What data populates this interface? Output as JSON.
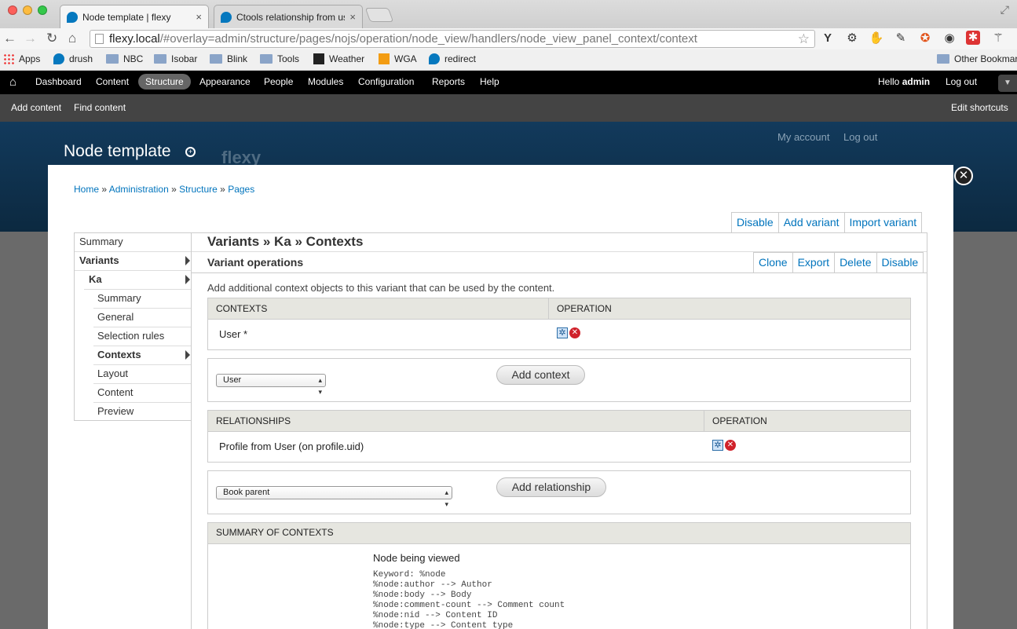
{
  "browser": {
    "tabs": [
      {
        "title": "Node template | flexy",
        "close": "×"
      },
      {
        "title": "Ctools relationship from us",
        "close": "×"
      }
    ],
    "url_host": "flexy.local",
    "url_path": "/#overlay=admin/structure/pages/nojs/operation/node_view/handlers/node_view_panel_context/context",
    "extensions": [
      "Y",
      "⚙",
      "✋",
      "✎",
      "✪",
      "◉",
      "✱",
      "⚚"
    ],
    "bookmarks": [
      {
        "label": "Apps",
        "icon": "apps-grid-icon"
      },
      {
        "label": "drush",
        "icon": "drupal-icon"
      },
      {
        "label": "NBC",
        "icon": "folder-icon"
      },
      {
        "label": "Isobar",
        "icon": "folder-icon"
      },
      {
        "label": "Blink",
        "icon": "folder-icon"
      },
      {
        "label": "Tools",
        "icon": "folder-icon"
      },
      {
        "label": "Weather",
        "icon": "weather-icon"
      },
      {
        "label": "WGA",
        "icon": "wga-icon"
      },
      {
        "label": "redirect",
        "icon": "drupal-icon"
      }
    ],
    "other_bookmarks": "Other Bookmarks"
  },
  "admin_menu": {
    "items": [
      "Dashboard",
      "Content",
      "Structure",
      "Appearance",
      "People",
      "Modules",
      "Configuration",
      "Reports",
      "Help"
    ],
    "active": "Structure",
    "hello": "Hello",
    "user": "admin",
    "logout": "Log out"
  },
  "shortcuts": {
    "add_content": "Add content",
    "find_content": "Find content",
    "edit_shortcuts": "Edit shortcuts"
  },
  "background": {
    "my_account": "My account",
    "logout": "Log out",
    "site_name": "flexy"
  },
  "overlay": {
    "title": "Node template",
    "close": "✕",
    "breadcrumb": [
      "Home",
      "Administration",
      "Structure",
      "Pages"
    ],
    "breadcrumb_sep": "»",
    "top_buttons": [
      "Disable",
      "Add variant",
      "Import variant"
    ],
    "left_tabs": [
      {
        "label": "Summary",
        "level": 0,
        "bold": false,
        "arrow": false
      },
      {
        "label": "Variants",
        "level": 0,
        "bold": true,
        "arrow": true
      },
      {
        "label": "Ka",
        "level": 1,
        "bold": true,
        "arrow": true
      },
      {
        "label": "Summary",
        "level": 2,
        "bold": false,
        "arrow": false
      },
      {
        "label": "General",
        "level": 2,
        "bold": false,
        "arrow": false
      },
      {
        "label": "Selection rules",
        "level": 2,
        "bold": false,
        "arrow": false
      },
      {
        "label": "Contexts",
        "level": 2,
        "bold": true,
        "arrow": true
      },
      {
        "label": "Layout",
        "level": 2,
        "bold": false,
        "arrow": false
      },
      {
        "label": "Content",
        "level": 2,
        "bold": false,
        "arrow": false
      },
      {
        "label": "Preview",
        "level": 2,
        "bold": false,
        "arrow": false
      }
    ],
    "variant_title": "Variants » Ka » Contexts",
    "variant_operations": "Variant operations",
    "variant_buttons": [
      "Clone",
      "Export",
      "Delete",
      "Disable"
    ],
    "description": "Add additional context objects to this variant that can be used by the content.",
    "contexts": {
      "headers": [
        "CONTEXTS",
        "OPERATION"
      ],
      "rows": [
        {
          "name": "User *"
        }
      ],
      "select_value": "User",
      "add_button": "Add context"
    },
    "relationships": {
      "headers": [
        "RELATIONSHIPS",
        "OPERATION"
      ],
      "rows": [
        {
          "name": "Profile from User (on profile.uid)"
        }
      ],
      "select_value": "Book parent",
      "add_button": "Add relationship"
    },
    "summary": {
      "header": "SUMMARY OF CONTEXTS",
      "context_name": "Node being viewed",
      "lines": [
        "Keyword: %node",
        "%node:author --> Author",
        "%node:body --> Body",
        "%node:comment-count --> Comment count",
        "%node:nid --> Content ID",
        "%node:type --> Content type"
      ]
    }
  }
}
